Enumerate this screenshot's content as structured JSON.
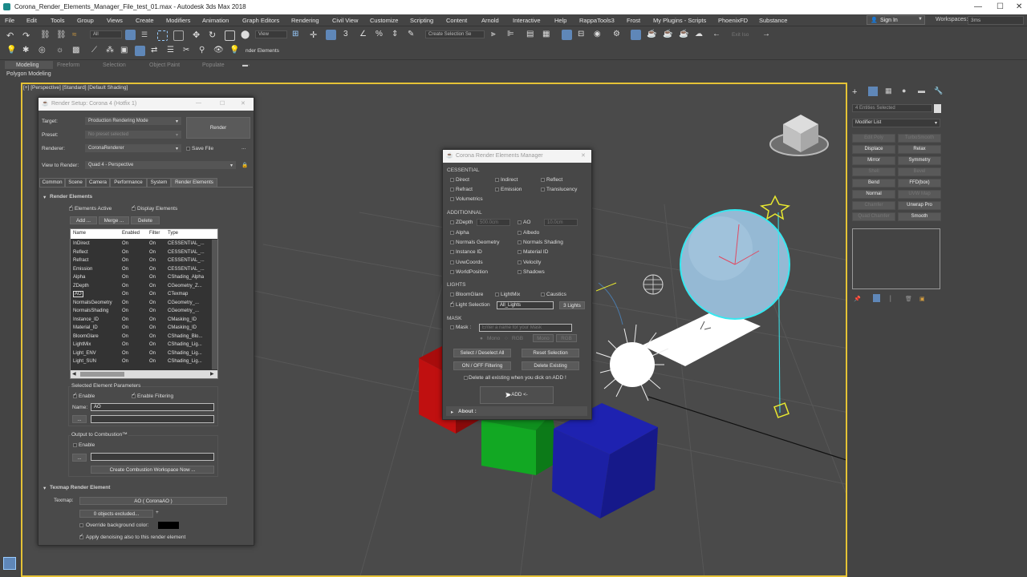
{
  "window": {
    "title": "Corona_Render_Elements_Manager_File_test_01.max - Autodesk 3ds Max 2018"
  },
  "menu": [
    "File",
    "Edit",
    "Tools",
    "Group",
    "Views",
    "Create",
    "Modifiers",
    "Animation",
    "Graph Editors",
    "Rendering",
    "Civil View",
    "Customize",
    "Scripting",
    "Content",
    "Arnold",
    "Interactive",
    "Help",
    "RappaTools3",
    "Frost",
    "My Plugins - Scripts",
    "PhoenixFD",
    "Substance"
  ],
  "account": {
    "signin": "Sign In",
    "workspaces_label": "Workspaces:",
    "workspace_value": "3ms"
  },
  "toolbar": {
    "filter_value": "All",
    "view_value": "View",
    "selection_set_placeholder": "Create Selection Se",
    "exit_iso": "Exit Iso",
    "render_elements_label": "nder Elements"
  },
  "ribbon": {
    "tabs": [
      "Modeling",
      "Freeform",
      "Selection",
      "Object Paint",
      "Populate"
    ],
    "sub": "Polygon Modeling"
  },
  "viewport": {
    "label": "[+] [Perspective] [Standard] [Default Shading]"
  },
  "render_setup": {
    "title": "Render Setup: Corona 4 (Hotfix 1)",
    "target_label": "Target:",
    "target_value": "Production Rendering Mode",
    "preset_label": "Preset:",
    "preset_value": "No preset selected",
    "renderer_label": "Renderer:",
    "renderer_value": "CoronaRenderer",
    "save_file": "Save File",
    "render_button": "Render",
    "view_label": "View to Render:",
    "view_value": "Quad 4 - Perspective",
    "tabs": [
      "Common",
      "Scene",
      "Camera",
      "Performance",
      "System",
      "Render Elements"
    ],
    "rollout_title": "Render Elements",
    "elements_active": "Elements Active",
    "display_elements": "Display Elements",
    "add": "Add ...",
    "merge": "Merge ...",
    "delete": "Delete",
    "columns": [
      "Name",
      "Enabled",
      "Filter",
      "Type"
    ],
    "rows": [
      [
        "InDirect",
        "On",
        "On",
        "CESSENTIAL_..."
      ],
      [
        "Reflect",
        "On",
        "On",
        "CESSENTIAL_..."
      ],
      [
        "Refract",
        "On",
        "On",
        "CESSENTIAL_..."
      ],
      [
        "Emission",
        "On",
        "On",
        "CESSENTIAL_..."
      ],
      [
        "Alpha",
        "On",
        "On",
        "CShading_Alpha"
      ],
      [
        "ZDepth",
        "On",
        "On",
        "CGeometry_Z..."
      ],
      [
        "AO",
        "On",
        "On",
        "CTexmap"
      ],
      [
        "NormalsGeometry",
        "On",
        "On",
        "CGeometry_..."
      ],
      [
        "NormalsShading",
        "On",
        "On",
        "CGeometry_..."
      ],
      [
        "Instance_ID",
        "On",
        "On",
        "CMasking_ID"
      ],
      [
        "Material_ID",
        "On",
        "On",
        "CMasking_ID"
      ],
      [
        "BloomGlare",
        "On",
        "On",
        "CShading_Blo..."
      ],
      [
        "LightMix",
        "On",
        "On",
        "CShading_Lig..."
      ],
      [
        "Light_ENV",
        "On",
        "On",
        "CShading_Lig..."
      ],
      [
        "Light_SUN",
        "On",
        "On",
        "CShading_Lig..."
      ]
    ],
    "sel_params_title": "Selected Element Parameters",
    "enable": "Enable",
    "enable_filtering": "Enable Filtering",
    "name_label": "Name:",
    "name_value": "AO",
    "dots": "...",
    "combustion_title": "Output to Combustion™",
    "combustion_enable": "Enable",
    "combustion_button": "Create Combustion Workspace Now ...",
    "texmap_rollout": "Texmap Render Element",
    "texmap_label": "Texmap:",
    "texmap_value": "AO  ( CoronaAO )",
    "excluded": "0 objects excluded...",
    "plus": "+",
    "override_bg": "Override background color:",
    "apply_denoise": "Apply denoising also to this render element"
  },
  "rem": {
    "title": "Corona Render Elements Manager",
    "essential": "CESSENTIAL",
    "ess_items": [
      "Direct",
      "Indirect",
      "Reflect",
      "Refract",
      "Emission",
      "Translucency",
      "Volumetrics"
    ],
    "additional": "ADDITIONNAL",
    "zdepth": "ZDepth",
    "zdepth_value": "500.0cm",
    "ao": "AO",
    "ao_value": "10.0cm",
    "add_items": [
      "Alpha",
      "Albedo",
      "Normals Geometry",
      "Normals Shading",
      "Instance ID",
      "Material ID",
      "UvwCoords",
      "Velocity",
      "WorldPosition",
      "Shadows"
    ],
    "lights": "LIGHTS",
    "bloom": "BloomGlare",
    "lightmix": "LightMix",
    "caustics": "Caustics",
    "light_selection": "Light Selection",
    "light_sel_value": "All_Lights",
    "lights_count": "3 Lights",
    "mask": "MASK",
    "mask_label": "Mask :",
    "mask_placeholder": "Enter a name for your Mask",
    "mono": "Mono",
    "rgb": "RGB",
    "mono_btn": "Mono",
    "rgb_btn": "RGB",
    "select_all": "Select / Deselect All",
    "reset": "Reset Selection",
    "on_off": "ON / OFF Filtering",
    "delete_existing": "Delete Existing",
    "delete_all_note": "Delete all existing when you dick on ADD !",
    "add_btn": "-> ADD <-",
    "about": "About :"
  },
  "cmd": {
    "selected": "4 Entities Selected",
    "modifier_list": "Modifier List",
    "buttons": [
      [
        "Edit Poly",
        "TurboSmooth"
      ],
      [
        "Displace",
        "Relax"
      ],
      [
        "Mirror",
        "Symmetry"
      ],
      [
        "Shell",
        "Bevel"
      ],
      [
        "Bend",
        "FFD(box)"
      ],
      [
        "Normal",
        "UVW Map"
      ],
      [
        "Chamfer",
        "Unwrap Pro"
      ],
      [
        "Quad Chamfer",
        "Smooth"
      ]
    ],
    "dim": [
      [
        true,
        true
      ],
      [
        false,
        false
      ],
      [
        false,
        false
      ],
      [
        true,
        true
      ],
      [
        false,
        false
      ],
      [
        false,
        true
      ],
      [
        true,
        false
      ],
      [
        true,
        false
      ]
    ]
  }
}
